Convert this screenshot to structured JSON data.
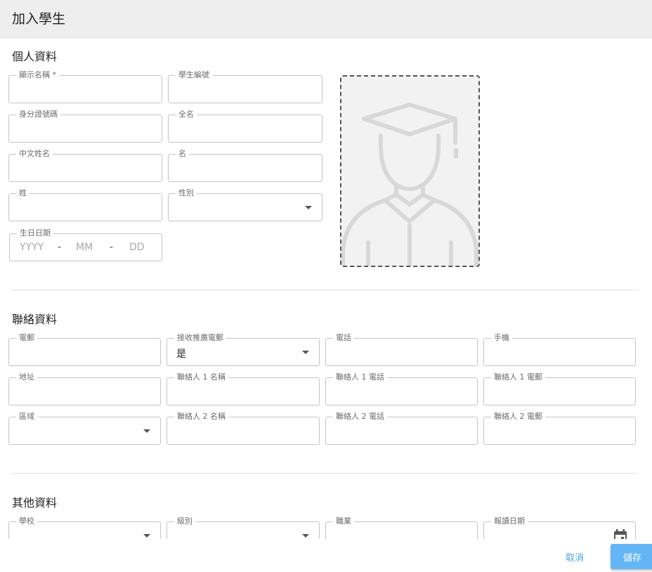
{
  "dialog": {
    "title": "加入學生"
  },
  "personal": {
    "title": "個人資料",
    "display_name": {
      "label": "顯示名稱 *",
      "value": ""
    },
    "student_no": {
      "label": "學生編號",
      "value": ""
    },
    "id_no": {
      "label": "身分證號碼",
      "value": ""
    },
    "full_name": {
      "label": "全名",
      "value": ""
    },
    "chinese_name": {
      "label": "中文姓名",
      "value": ""
    },
    "first_name": {
      "label": "名",
      "value": ""
    },
    "last_name": {
      "label": "姓",
      "value": ""
    },
    "gender": {
      "label": "性別",
      "value": ""
    },
    "birthday": {
      "label": "生日日期",
      "year_ph": "YYYY",
      "month_ph": "MM",
      "day_ph": "DD",
      "sep": "-"
    }
  },
  "contact": {
    "title": "聯絡資料",
    "email": {
      "label": "電郵",
      "value": ""
    },
    "promo": {
      "label": "接收推廣電郵",
      "value": "是"
    },
    "phone": {
      "label": "電話",
      "value": ""
    },
    "mobile": {
      "label": "手機",
      "value": ""
    },
    "address": {
      "label": "地址",
      "value": ""
    },
    "c1_name": {
      "label": "聯絡人 1 名稱",
      "value": ""
    },
    "c1_phone": {
      "label": "聯絡人 1 電話",
      "value": ""
    },
    "c1_email": {
      "label": "聯絡人 1 電郵",
      "value": ""
    },
    "region": {
      "label": "區域",
      "value": ""
    },
    "c2_name": {
      "label": "聯絡人 2 名稱",
      "value": ""
    },
    "c2_phone": {
      "label": "聯絡人 2 電話",
      "value": ""
    },
    "c2_email": {
      "label": "聯絡人 2 電郵",
      "value": ""
    }
  },
  "other": {
    "title": "其他資料",
    "school": {
      "label": "學校",
      "value": ""
    },
    "level": {
      "label": "級別",
      "value": ""
    },
    "occupation": {
      "label": "職業",
      "value": ""
    },
    "enroll_date": {
      "label": "報讀日期",
      "value": ""
    }
  },
  "footer": {
    "cancel_label": "取消",
    "save_label": "儲存"
  },
  "icons": {
    "photo_placeholder": "graduate-avatar-icon",
    "calendar": "calendar-icon",
    "dropdown": "caret-down-icon"
  },
  "colors": {
    "header_bg": "#eeeeee",
    "accent": "#4aa3e6",
    "save_bg": "#64b5f6",
    "border": "#c4c4c4"
  }
}
